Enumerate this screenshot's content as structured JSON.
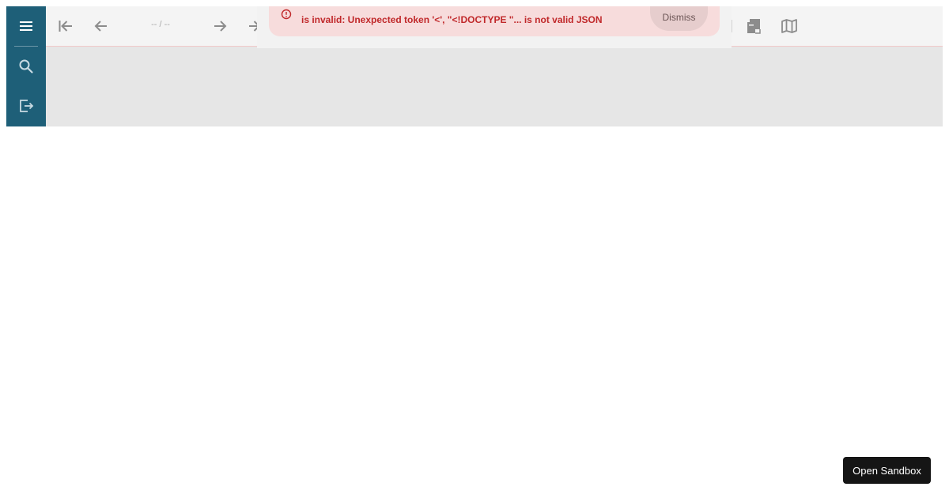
{
  "toolbar": {
    "page_indicator": "-- / --",
    "icons": [
      "first-page-icon",
      "previous-page-icon",
      "next-page-icon",
      "last-page-icon",
      "book-icon",
      "map-icon"
    ]
  },
  "sidebar": {
    "icons": [
      "menu-icon",
      "search-icon",
      "exit-icon"
    ]
  },
  "error_toast": {
    "message": "is invalid: Unexpected token '<', \"<!DOCTYPE \"... is not valid JSON",
    "dismiss_label": "Dismiss",
    "icon": "error-icon"
  },
  "sandbox": {
    "label": "Open Sandbox"
  },
  "colors": {
    "sidebar": "#1e5f78",
    "toolbar": "#f4f4f4",
    "content": "#e6e6e6",
    "toast_bg": "#f7dcdc",
    "toast_text": "#c0282a",
    "sandbox_bg": "#151515"
  }
}
